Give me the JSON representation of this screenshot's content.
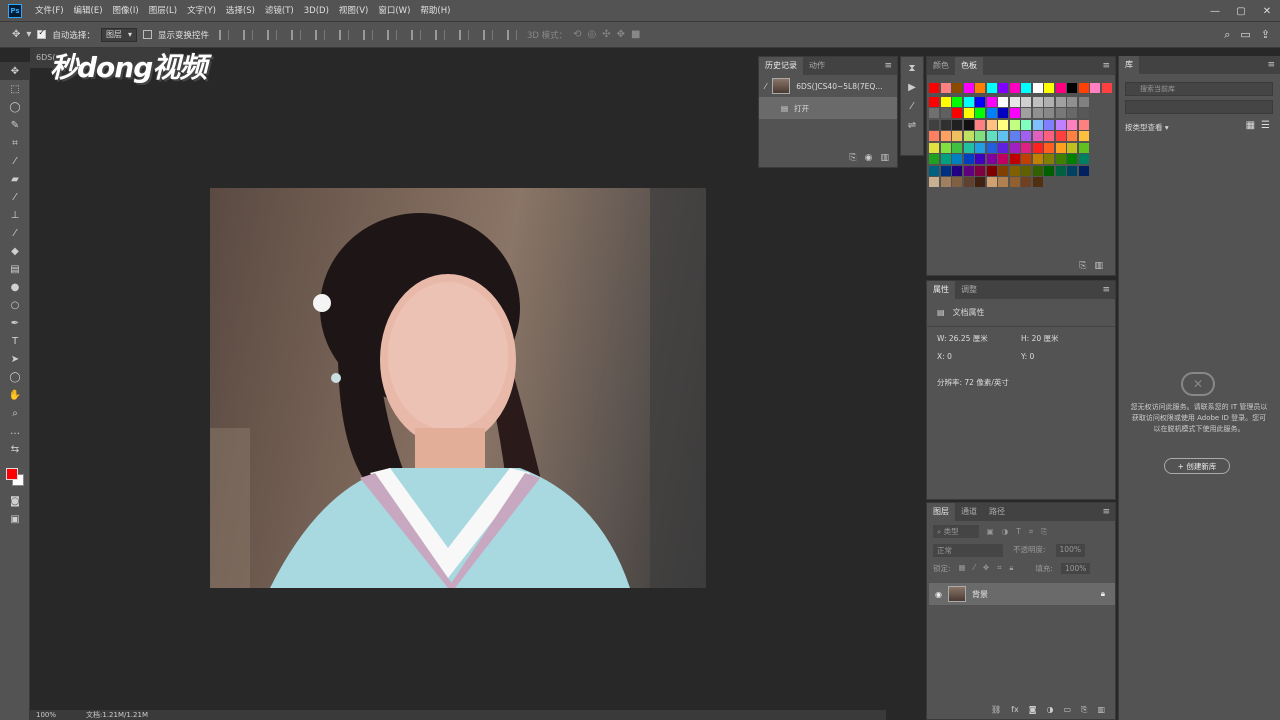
{
  "menubar": {
    "logo": "Ps",
    "items": [
      "文件(F)",
      "编辑(E)",
      "图像(I)",
      "图层(L)",
      "文字(Y)",
      "选择(S)",
      "滤镜(T)",
      "3D(D)",
      "视图(V)",
      "窗口(W)",
      "帮助(H)"
    ]
  },
  "options": {
    "auto_select_label": "自动选择：",
    "auto_select_target": "图层",
    "show_transform_label": "显示变换控件",
    "mode_3d_label": "3D 模式："
  },
  "watermark": "秒dong视频",
  "document": {
    "tab_title": "6DS(",
    "zoom": "100%",
    "doc_size": "文档:1.21M/1.21M"
  },
  "history_panel": {
    "tabs": [
      "历史记录",
      "动作"
    ],
    "snapshot_name": "6DS(]CS40~5L8(7EQ...",
    "steps": [
      "打开"
    ]
  },
  "swatches_panel": {
    "tabs": [
      "颜色",
      "色板"
    ],
    "colors": [
      [
        "#ff0000",
        "#ff8080",
        "#8a4a00",
        "#ff00ff",
        "#ff8000",
        "#00ffff",
        "#8000ff",
        "#ff00c0",
        "#00ffff",
        "#ffffff",
        "#ffff00",
        "#ff0080",
        "#000000",
        "#ff4000",
        "#ff80c0",
        "#ff4040"
      ],
      [
        "#ff0000",
        "#ffff00",
        "#00ff00",
        "#00ffff",
        "#0000ff",
        "#ff00ff",
        "#ffffff",
        "#e6e6e6",
        "#d0d0d0",
        "#bfbfbf",
        "#b0b0b0",
        "#a0a0a0",
        "#909090",
        "#808080"
      ],
      [
        "#707070",
        "#606060",
        "#ff0000",
        "#ffff00",
        "#00ff00",
        "#0080ff",
        "#0000c0",
        "#ff00ff",
        "#a0a0a0",
        "#909090",
        "#888888",
        "#787878",
        "#686868",
        "#585858"
      ],
      [
        "#404040",
        "#303030",
        "#202020",
        "#101010",
        "#ff8080",
        "#ffc080",
        "#ffff80",
        "#c0ff80",
        "#80ffc0",
        "#80c0ff",
        "#8080ff",
        "#c080ff",
        "#ff80c0",
        "#ff8080"
      ],
      [
        "#ff8060",
        "#ffa060",
        "#f0c060",
        "#c0e060",
        "#80e080",
        "#60e0c0",
        "#60c0f0",
        "#6080f0",
        "#a060f0",
        "#e060c0",
        "#ff6080",
        "#ff4040",
        "#ff8040",
        "#ffc040"
      ],
      [
        "#e0e040",
        "#80e040",
        "#40c040",
        "#20c0a0",
        "#20a0e0",
        "#2060e0",
        "#6020e0",
        "#a020c0",
        "#e02080",
        "#ff2020",
        "#ff6020",
        "#ffa020",
        "#c0c020",
        "#60c020"
      ],
      [
        "#20a020",
        "#00a080",
        "#0080c0",
        "#0040c0",
        "#4000c0",
        "#8000a0",
        "#c00060",
        "#c00000",
        "#c04000",
        "#c08000",
        "#808000",
        "#408000",
        "#008000",
        "#008060"
      ],
      [
        "#006080",
        "#003080",
        "#200080",
        "#600080",
        "#800040",
        "#800000",
        "#804000",
        "#806000",
        "#606000",
        "#306000",
        "#006000",
        "#006040",
        "#004060",
        "#002060"
      ],
      [
        "#c8b090",
        "#a08060",
        "#806040",
        "#604030",
        "#402010",
        "#d0a070",
        "#b08050",
        "#906030",
        "#704020",
        "#503010"
      ]
    ]
  },
  "properties_panel": {
    "tabs": [
      "属性",
      "调整"
    ],
    "section_title": "文档属性",
    "width_label": "W:",
    "width_value": "26.25 厘米",
    "height_label": "H:",
    "height_value": "20 厘米",
    "x_label": "X:",
    "x_value": "0",
    "y_label": "Y:",
    "y_value": "0",
    "resolution": "分辨率: 72 像素/英寸"
  },
  "layers_panel": {
    "tabs": [
      "图层",
      "通道",
      "路径"
    ],
    "search_placeholder": "类型",
    "blend_mode": "正常",
    "opacity_label": "不透明度:",
    "opacity_value": "100%",
    "lock_label": "锁定:",
    "fill_label": "填充:",
    "fill_value": "100%",
    "layers": [
      {
        "name": "背景"
      }
    ]
  },
  "library_panel": {
    "tab": "库",
    "search_placeholder": "搜索当前库",
    "view_label": "按类型查看",
    "message": "您无权访问此服务。请联系您的 IT 管理员以获取访问权限或使用 Adobe ID 登录。您可以在脱机模式下使用此服务。",
    "create_button": "+ 创建新库"
  }
}
